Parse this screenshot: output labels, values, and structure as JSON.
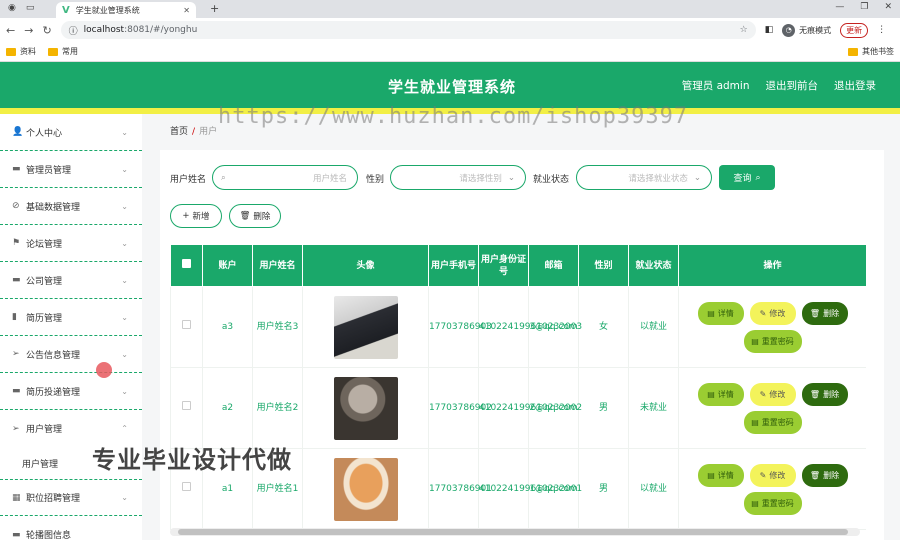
{
  "browser": {
    "tab_title": "学生就业管理系统",
    "url_host": "localhost",
    "url_path": ":8081/#/yonghu",
    "incognito_label": "无痕模式",
    "update_label": "更新",
    "bookmarks": [
      "资料",
      "常用"
    ],
    "other_bookmarks": "其他书签"
  },
  "header": {
    "title": "学生就业管理系统",
    "nav": [
      "管理员 admin",
      "退出到前台",
      "退出登录"
    ]
  },
  "sidebar": {
    "items": [
      {
        "label": "个人中心",
        "icon": "user-icon"
      },
      {
        "label": "管理员管理",
        "icon": "monitor-icon"
      },
      {
        "label": "基础数据管理",
        "icon": "compass-icon"
      },
      {
        "label": "论坛管理",
        "icon": "flag-icon"
      },
      {
        "label": "公司管理",
        "icon": "monitor-icon"
      },
      {
        "label": "简历管理",
        "icon": "chart-icon"
      },
      {
        "label": "公告信息管理",
        "icon": "send-icon"
      },
      {
        "label": "简历投递管理",
        "icon": "monitor-icon"
      },
      {
        "label": "用户管理",
        "icon": "send-icon"
      }
    ],
    "sub_item": "用户管理",
    "after_items": [
      {
        "label": "职位招聘管理",
        "icon": "grid-icon"
      },
      {
        "label": "轮播图信息",
        "icon": "chat-icon"
      }
    ]
  },
  "breadcrumb": {
    "home": "首页",
    "sep": "/",
    "current": "用户"
  },
  "search": {
    "name_label": "用户姓名",
    "name_placeholder": "用户姓名",
    "gender_label": "性别",
    "gender_placeholder": "请选择性别",
    "status_label": "就业状态",
    "status_placeholder": "请选择就业状态",
    "query_label": "查询"
  },
  "actions": {
    "add": "新增",
    "delete": "删除"
  },
  "table": {
    "headers": [
      "账户",
      "用户姓名",
      "头像",
      "用户手机号",
      "用户身份证号",
      "邮箱",
      "性别",
      "就业状态",
      "操作"
    ],
    "rows": [
      {
        "account": "a3",
        "name": "用户姓名3",
        "phone": "17703786903",
        "idcard": "410224199610232003",
        "email": "3@qq.com",
        "gender": "女",
        "status": "以就业"
      },
      {
        "account": "a2",
        "name": "用户姓名2",
        "phone": "17703786902",
        "idcard": "410224199610232002",
        "email": "2@qq.com",
        "gender": "男",
        "status": "未就业"
      },
      {
        "account": "a1",
        "name": "用户姓名1",
        "phone": "17703786901",
        "idcard": "410224199610232001",
        "email": "1@qq.com",
        "gender": "男",
        "status": "以就业"
      }
    ],
    "ops": {
      "detail": "详情",
      "edit": "修改",
      "delete": "删除",
      "reset": "重置密码"
    }
  },
  "watermarks": {
    "url": "https://www.huzhan.com/ishop39397",
    "promo": "专业毕业设计代做"
  },
  "colors": {
    "primary": "#1aa86a",
    "accent": "#f2ef45",
    "detail_btn": "#9acd32",
    "edit_btn": "#f3f35b",
    "delete_btn": "#2e6b0f"
  }
}
